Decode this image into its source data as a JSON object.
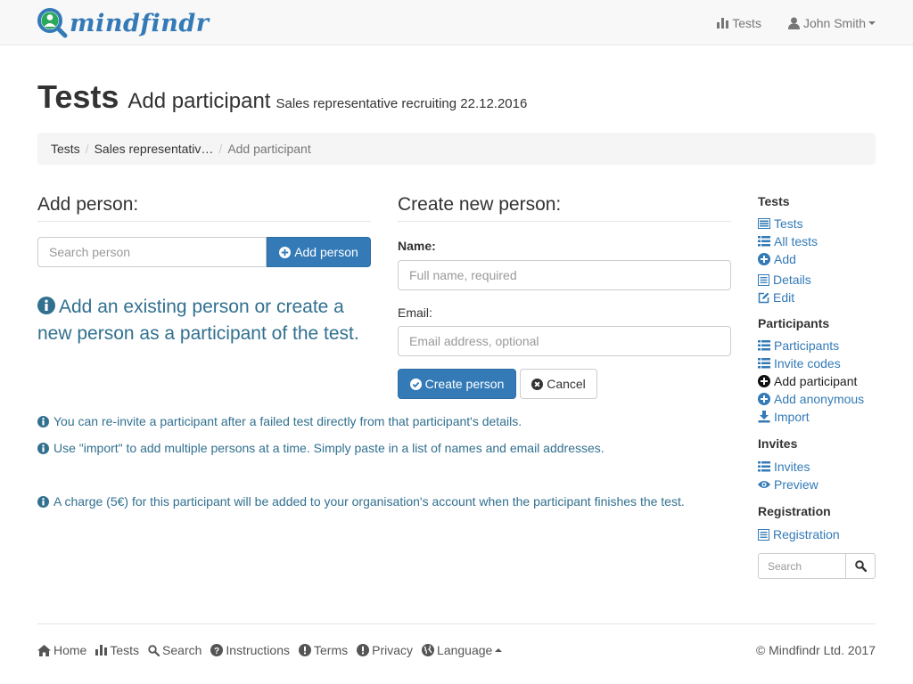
{
  "colors": {
    "brand": "#337ab7",
    "info_text": "#31708f",
    "navbar_bg": "#f8f8f8",
    "breadcrumb_bg": "#f5f5f5"
  },
  "navbar": {
    "logo_text": "mindfindr",
    "logo_icon": "magnifier-person-icon",
    "links": [
      {
        "label": "Tests",
        "icon": "bar-chart-icon"
      },
      {
        "label": "John Smith",
        "icon": "user-icon"
      }
    ]
  },
  "header": {
    "title": "Tests",
    "subtitle": "Add participant",
    "small": "Sales representative recruiting 22.12.2016"
  },
  "breadcrumb": [
    "Tests",
    "Sales representativ…",
    "Add participant"
  ],
  "add_person": {
    "title": "Add person:",
    "search_placeholder": "Search person",
    "button_label": "Add person",
    "info": "Add an existing person or create a new person as a participant of the test."
  },
  "create_person": {
    "title": "Create new person:",
    "name_label": "Name:",
    "name_placeholder": "Full name, required",
    "email_label": "Email:",
    "email_placeholder": "Email address, optional",
    "create_button": "Create person",
    "cancel_button": "Cancel"
  },
  "notes": [
    "You can re-invite a participant after a failed test directly from that participant's details.",
    "Use \"import\" to add multiple persons at a time. Simply paste in a list of names and email addresses.",
    "A charge (5€) for this participant will be added to your organisation's account when the participant finishes the test."
  ],
  "sidebar": {
    "sections": [
      {
        "title": "Tests",
        "items": [
          {
            "label": "Tests",
            "icon": "list-alt-icon"
          },
          {
            "label": "All tests",
            "icon": "list-icon"
          },
          {
            "label": "Add",
            "icon": "plus-circle-icon"
          },
          {
            "label": "Details",
            "icon": "document-icon"
          },
          {
            "label": "Edit",
            "icon": "edit-icon"
          }
        ]
      },
      {
        "title": "Participants",
        "items": [
          {
            "label": "Participants",
            "icon": "list-icon"
          },
          {
            "label": "Invite codes",
            "icon": "list-icon"
          },
          {
            "label": "Add participant",
            "icon": "plus-circle-icon",
            "active": true
          },
          {
            "label": "Add anonymous",
            "icon": "plus-circle-icon"
          },
          {
            "label": "Import",
            "icon": "import-icon"
          }
        ]
      },
      {
        "title": "Invites",
        "items": [
          {
            "label": "Invites",
            "icon": "list-icon"
          },
          {
            "label": "Preview",
            "icon": "eye-icon"
          }
        ]
      },
      {
        "title": "Registration",
        "items": [
          {
            "label": "Registration",
            "icon": "document-icon"
          }
        ]
      }
    ],
    "search_placeholder": "Search"
  },
  "footer": {
    "links": [
      {
        "label": "Home",
        "icon": "home-icon"
      },
      {
        "label": "Tests",
        "icon": "bar-chart-icon"
      },
      {
        "label": "Search",
        "icon": "search-icon"
      },
      {
        "label": "Instructions",
        "icon": "question-circle-icon"
      },
      {
        "label": "Terms",
        "icon": "exclamation-circle-icon"
      },
      {
        "label": "Privacy",
        "icon": "exclamation-circle-icon"
      },
      {
        "label": "Language",
        "icon": "globe-icon"
      }
    ],
    "copyright": "© Mindfindr Ltd. 2017"
  }
}
